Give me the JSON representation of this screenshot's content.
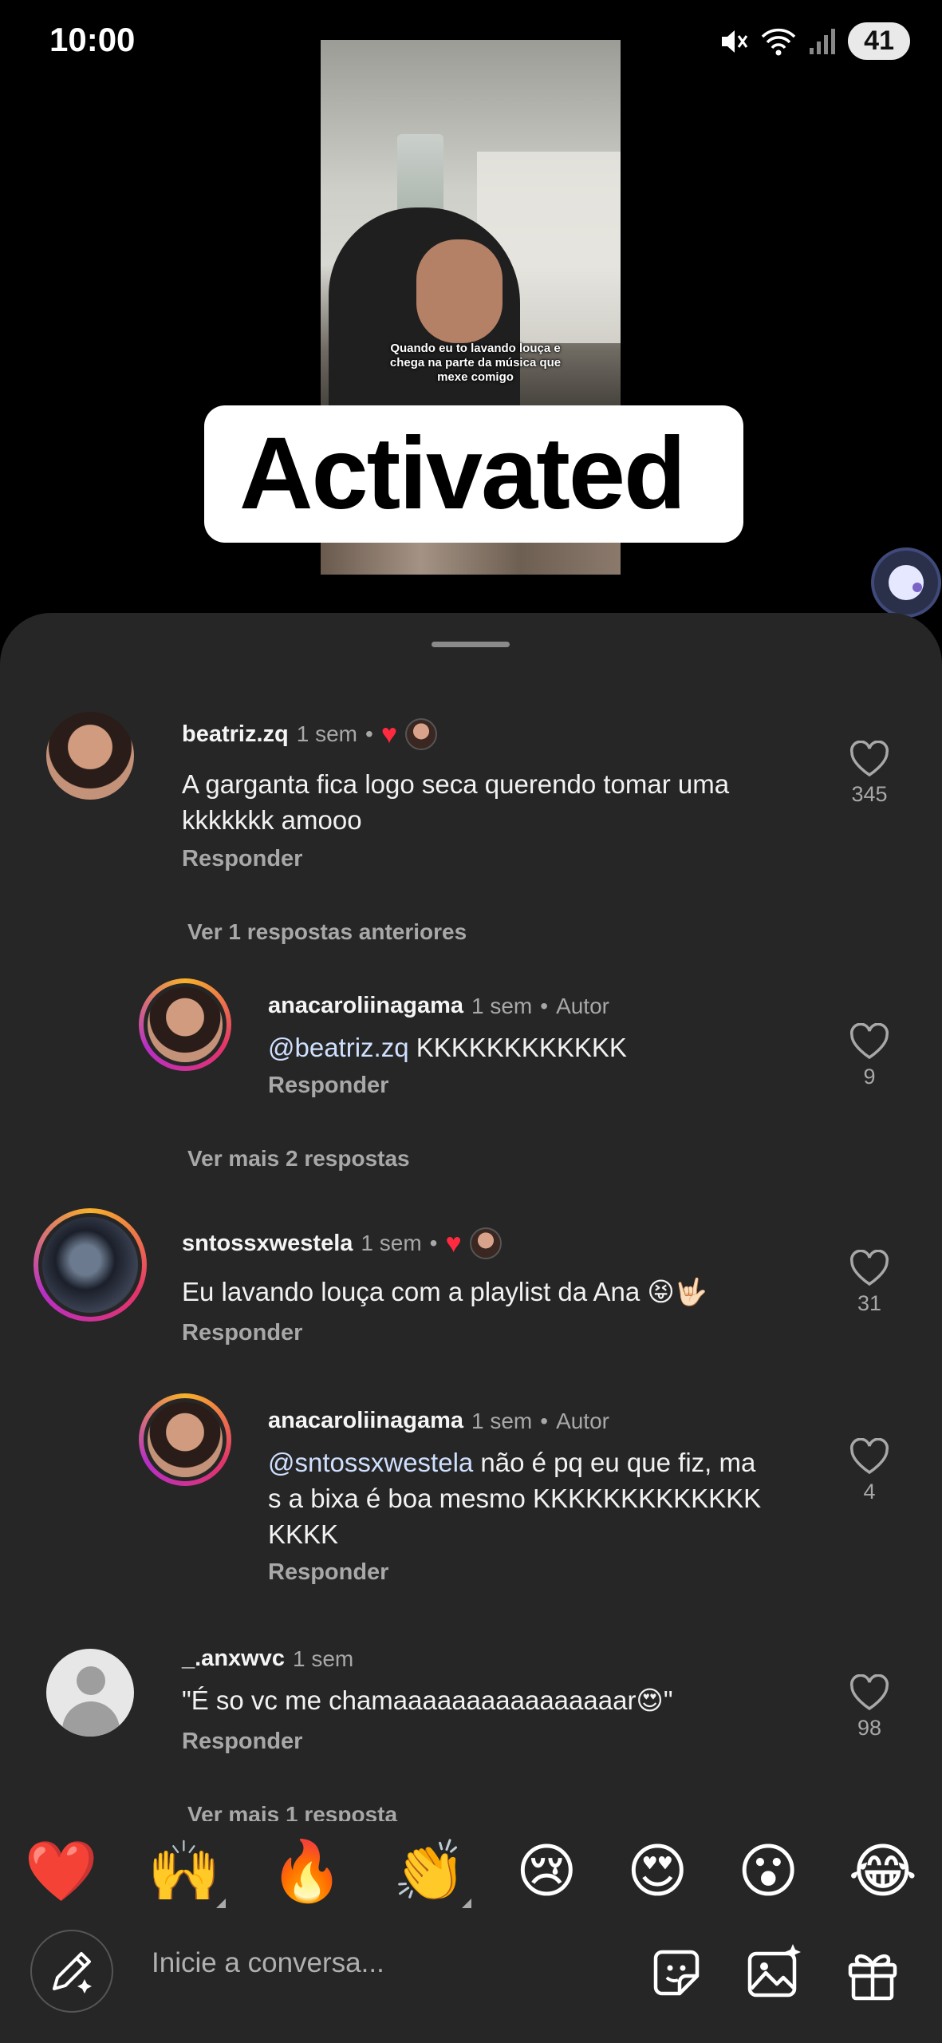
{
  "status_bar": {
    "time": "10:00",
    "battery": "41"
  },
  "video": {
    "caption": "Quando eu to lavando louça e chega na parte da música que mexe comigo",
    "sticker_text": "Activated"
  },
  "comments": [
    {
      "username": "beatriz.zq",
      "time": "1 sem",
      "text": "A garganta fica logo seca querendo tomar uma kkkkkkk amooo",
      "reply_label": "Responder",
      "likes": "345",
      "liked_by_author": true
    },
    {
      "username": "anacaroliinagama",
      "time": "1 sem",
      "badge": "Autor",
      "mention": "@beatriz.zq",
      "text": " KKKKKKKKKKKK",
      "reply_label": "Responder",
      "likes": "9"
    },
    {
      "username": "sntossxwestela",
      "time": "1 sem",
      "text": "Eu lavando louça com a playlist da Ana 😝🤟🏻",
      "reply_label": "Responder",
      "likes": "31",
      "liked_by_author": true
    },
    {
      "username": "anacaroliinagama",
      "time": "1 sem",
      "badge": "Autor",
      "mention": "@sntossxwestela",
      "text": " não é pq eu que fiz, mas a bixa é boa mesmo KKKKKKKKKKKKKKKKK",
      "reply_label": "Responder",
      "likes": "4"
    },
    {
      "username": "_.anxwvc",
      "time": "1 sem",
      "text": "\"É so vc me chamaaaaaaaaaaaaaaaar😍\"",
      "reply_label": "Responder",
      "likes": "98"
    }
  ],
  "threads": {
    "previous_replies": "Ver 1 respostas anteriores",
    "more_replies_1": "Ver mais 2 respostas",
    "more_replies_2": "Ver mais 1 resposta"
  },
  "emoji_reactions": [
    "❤️",
    "🙌",
    "🔥",
    "👏",
    "😢",
    "😍",
    "😮",
    "😂"
  ],
  "composer": {
    "placeholder": "Inicie a conversa..."
  },
  "icons": {
    "status": [
      "mute-icon",
      "wifi-icon",
      "signal-icon"
    ],
    "composer": [
      "pencil-sparkle-icon",
      "sticker-icon",
      "image-sparkle-icon",
      "gift-icon"
    ]
  }
}
